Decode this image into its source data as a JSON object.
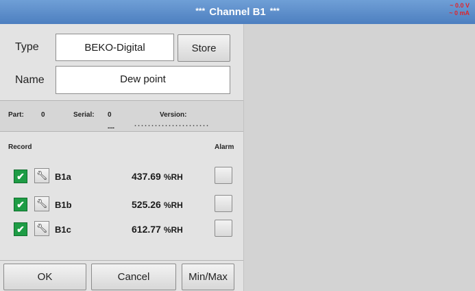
{
  "title": "Channel B1",
  "title_stars": "***",
  "readout": {
    "voltage": "~ 0.0 V",
    "current": "~ 0 mA"
  },
  "form": {
    "type_label": "Type",
    "type_value": "BEKO-Digital",
    "store_label": "Store",
    "name_label": "Name",
    "name_value": "Dew point"
  },
  "info": {
    "part_label": "Part:",
    "part_value": "0",
    "serial_label": "Serial:",
    "serial_value": "0",
    "version_label": "Version:",
    "version_value": "---"
  },
  "record_header": "Record",
  "alarm_header": "Alarm",
  "channels": [
    {
      "name": "B1a",
      "value": "437.69",
      "unit": "%RH",
      "record_checked": true
    },
    {
      "name": "B1b",
      "value": "525.26",
      "unit": "%RH",
      "record_checked": true
    },
    {
      "name": "B1c",
      "value": "612.77",
      "unit": "%RH",
      "record_checked": true
    }
  ],
  "icons": {
    "check": "checkmark-icon",
    "wrench": "wrench-icon"
  },
  "colors": {
    "titlebar": "#5a8bc9",
    "check": "#1e9c45",
    "readout": "#e0242b"
  },
  "buttons": {
    "ok": "OK",
    "cancel": "Cancel",
    "minmax": "Min/Max"
  }
}
